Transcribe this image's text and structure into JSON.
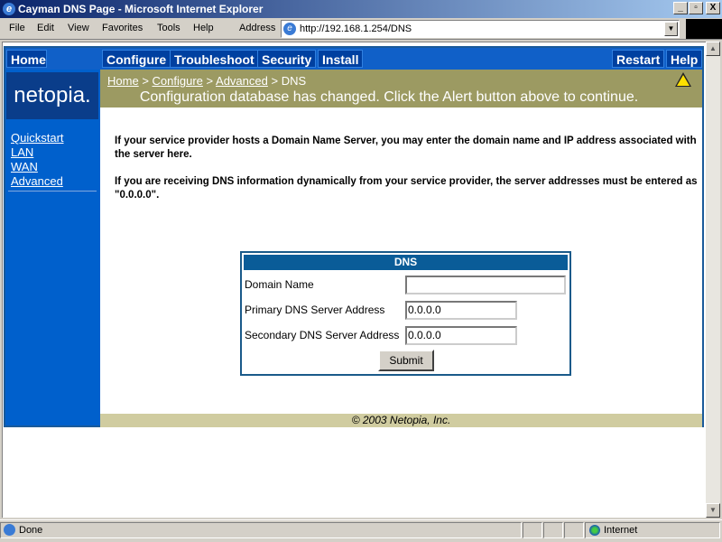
{
  "window": {
    "title": "Cayman DNS Page - Microsoft Internet Explorer",
    "minimize": "_",
    "maximize": "▫",
    "close": "X"
  },
  "menu": [
    "File",
    "Edit",
    "View",
    "Favorites",
    "Tools",
    "Help"
  ],
  "address": {
    "label": "Address",
    "url": "http://192.168.1.254/DNS"
  },
  "nav": {
    "home": "Home",
    "configure": "Configure",
    "troubleshoot": "Troubleshoot",
    "security": "Security",
    "install": "Install",
    "restart": "Restart",
    "help": "Help"
  },
  "logo": "netopia.",
  "sidebar": [
    "Quickstart",
    "LAN",
    "WAN",
    "Advanced"
  ],
  "breadcrumb": {
    "home": "Home",
    "configure": "Configure",
    "advanced": "Advanced",
    "current": "DNS",
    "sep": ">"
  },
  "alert": "Configuration database has changed. Click the Alert button above to continue.",
  "intro": [
    "If your service provider hosts a Domain Name Server, you may enter the domain name and IP address associated with the server here.",
    "If you are receiving DNS information dynamically from your service provider, the server addresses must be entered as \"0.0.0.0\"."
  ],
  "dns_form": {
    "title": "DNS",
    "domain_label": "Domain Name",
    "domain_value": "",
    "primary_label": "Primary DNS Server Address",
    "primary_value": "0.0.0.0",
    "secondary_label": "Secondary DNS Server Address",
    "secondary_value": "0.0.0.0",
    "submit": "Submit"
  },
  "footer": "© 2003 Netopia, Inc.",
  "status": {
    "text": "Done",
    "zone": "Internet"
  }
}
